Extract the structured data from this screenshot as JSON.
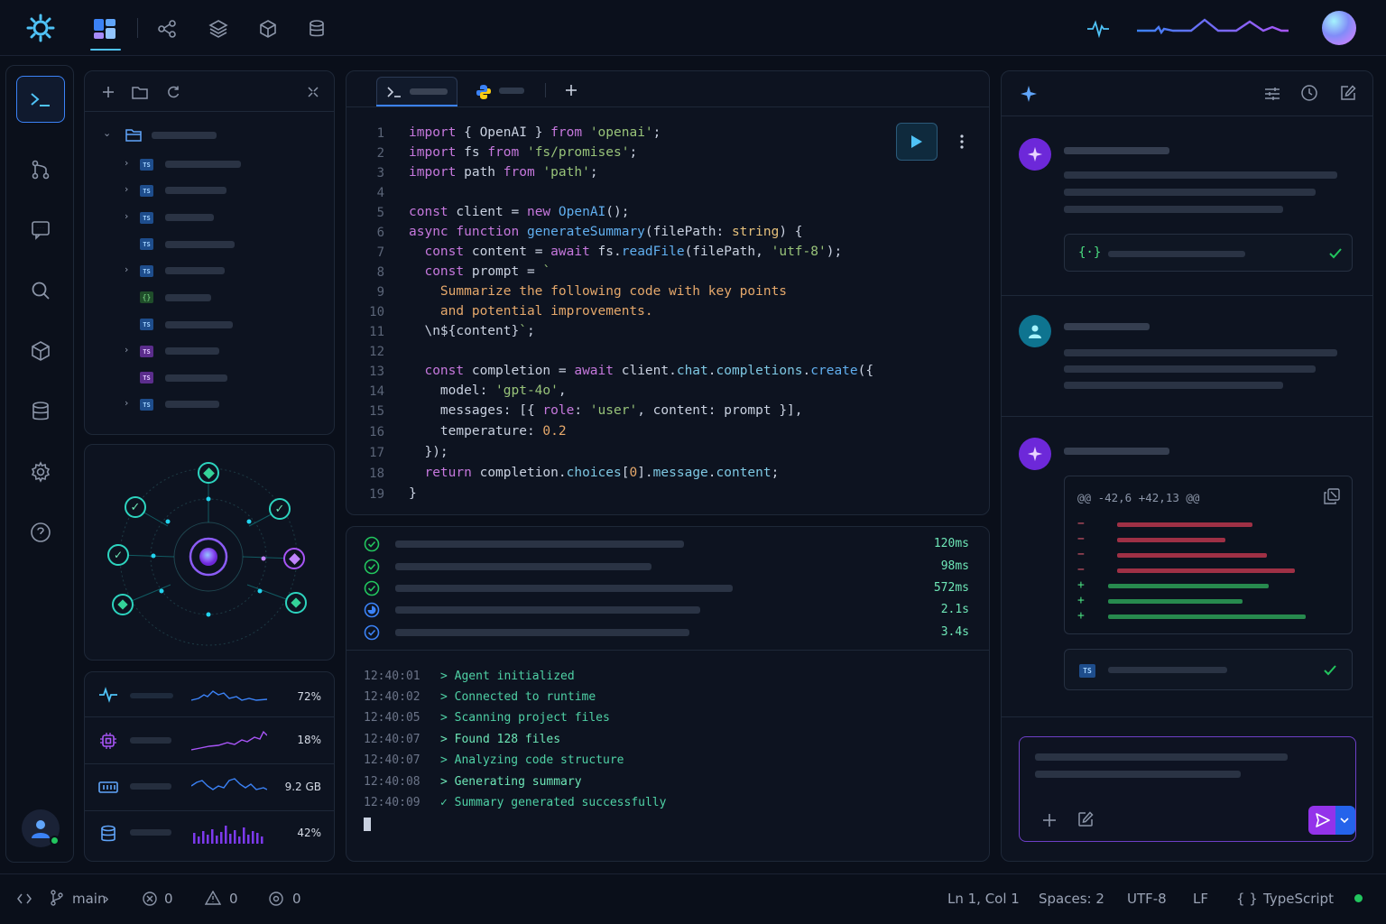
{
  "editor": {
    "line_numbers": [
      "1",
      "2",
      "3",
      "4",
      "5",
      "6",
      "7",
      "8",
      "9",
      "10",
      "11",
      "12",
      "13",
      "14",
      "15",
      "16",
      "17",
      "18",
      "19"
    ],
    "code_lines": [
      "import { OpenAI } from 'openai';",
      "import fs from 'fs/promises';",
      "import path from 'path';",
      "",
      "const client = new OpenAI();",
      "async function generateSummary(filePath: string) {",
      "  const content = await fs.readFile(filePath, 'utf-8');",
      "  const prompt = `",
      "    Summarize the following code with key points",
      "    and potential improvements.",
      "  \\n${content}`;",
      "",
      "  const completion = await client.chat.completions.create({",
      "    model: 'gpt-4o',",
      "    messages: [{ role: 'user', content: prompt }],",
      "    temperature: 0.2",
      "  });",
      "  return completion.choices[0].message.content;",
      "}"
    ]
  },
  "tasks": {
    "durations": [
      "120ms",
      "98ms",
      "572ms",
      "2.1s",
      "3.4s"
    ]
  },
  "logs": [
    {
      "time": "12:40:01",
      "msg": "> Agent initialized"
    },
    {
      "time": "12:40:02",
      "msg": "> Connected to runtime"
    },
    {
      "time": "12:40:05",
      "msg": "> Scanning project files"
    },
    {
      "time": "12:40:07",
      "msg": "> Found 128 files"
    },
    {
      "time": "12:40:07",
      "msg": "> Analyzing code structure"
    },
    {
      "time": "12:40:08",
      "msg": "> Generating summary"
    },
    {
      "time": "12:40:09",
      "msg": "✓ Summary generated successfully"
    }
  ],
  "metrics": [
    {
      "icon": "activity-icon",
      "value": "72%",
      "fraction": 0.72
    },
    {
      "icon": "cpu-icon",
      "value": "18%",
      "fraction": 0.18
    },
    {
      "icon": "memory-icon",
      "value": "9.2 GB"
    },
    {
      "icon": "database-icon",
      "value": "42%",
      "fraction": 0.42
    }
  ],
  "chat": {
    "json_icon": "{·}",
    "diff_header": "@@ -42,6 +42,13 @@",
    "diff_removed_markers": [
      "−",
      "−",
      "−",
      "−"
    ],
    "diff_added_markers": [
      "+",
      "+",
      "+"
    ],
    "ts_badge": "TS"
  },
  "statusbar": {
    "branch": "main",
    "errors": "0",
    "warnings": "0",
    "info": "0",
    "position": "Ln 1, Col 1",
    "spaces": "Spaces: 2",
    "encoding": "UTF-8",
    "eol": "LF",
    "language": "TypeScript"
  },
  "colors": {
    "accent": "#4fc3f7",
    "purple": "#a855f7",
    "success": "#22c55e",
    "removed": "#b0354a",
    "added": "#2f9e5a"
  }
}
